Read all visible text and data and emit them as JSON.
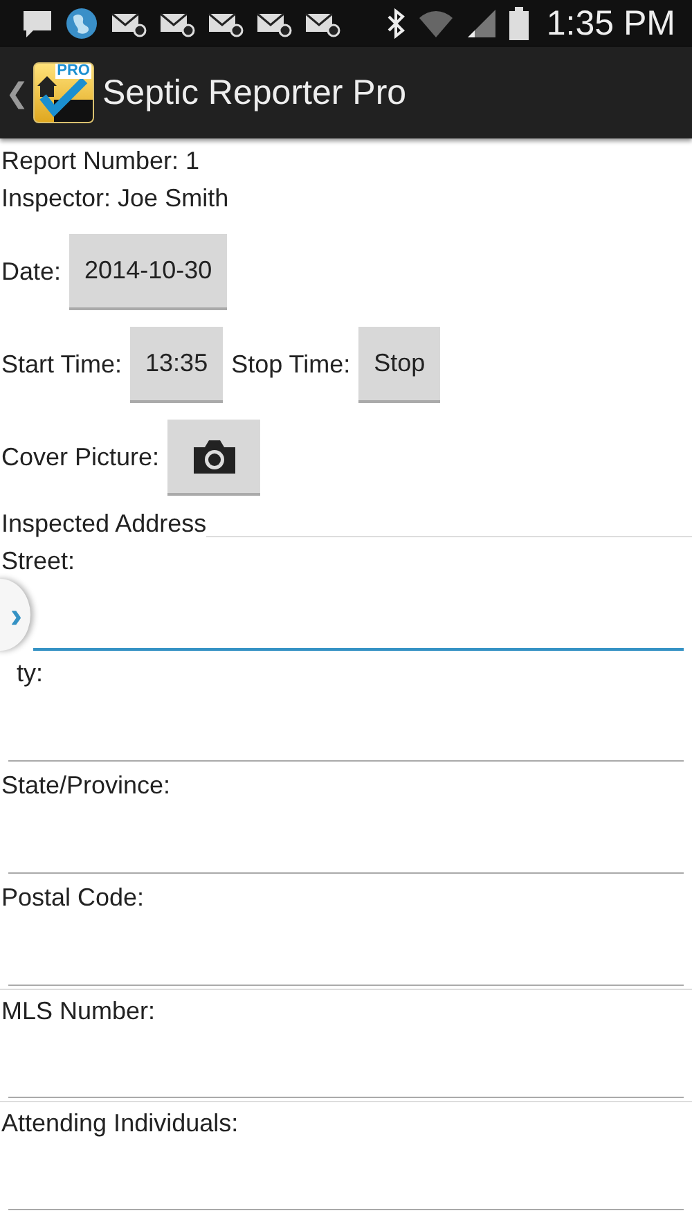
{
  "status_bar": {
    "time": "1:35 PM"
  },
  "action_bar": {
    "back": "❮",
    "title": "Septic Reporter Pro",
    "logo_badge": "PRO"
  },
  "header_lines": [
    {
      "text": "Report Number: 1"
    },
    {
      "text": "Inspector: Joe Smith"
    }
  ],
  "control_rows": [
    {
      "items": [
        {
          "kind": "label",
          "text": "Date:"
        },
        {
          "kind": "button",
          "text": "2014-10-30"
        }
      ]
    },
    {
      "items": [
        {
          "kind": "label",
          "text": "Start Time:"
        },
        {
          "kind": "button",
          "text": "13:35"
        },
        {
          "kind": "label",
          "text": "Stop Time:"
        },
        {
          "kind": "button",
          "text": "Stop"
        }
      ]
    },
    {
      "items": [
        {
          "kind": "label",
          "text": "Cover Picture:"
        },
        {
          "kind": "camera_button"
        }
      ]
    }
  ],
  "section": {
    "title": "Inspected Address"
  },
  "fields": [
    {
      "label": "Street:",
      "focused": true,
      "separated": false
    },
    {
      "label": "ty:",
      "focused": false,
      "separated": false
    },
    {
      "label": "State/Province:",
      "focused": false,
      "separated": false
    },
    {
      "label": "Postal Code:",
      "focused": false,
      "separated": false
    },
    {
      "label": "MLS Number:",
      "focused": false,
      "separated": true
    },
    {
      "label": "Attending Individuals:",
      "focused": false,
      "separated": true
    }
  ],
  "drawer_handle": {
    "glyph": "›"
  }
}
